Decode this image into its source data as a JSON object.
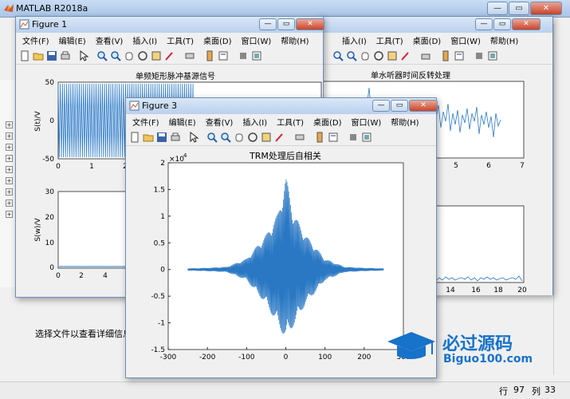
{
  "app": {
    "title": "MATLAB R2018a",
    "details_text": "选择文件以查看详细信息",
    "status": {
      "row_label": "行",
      "row_value": "97",
      "col_label": "列",
      "col_value": "33"
    }
  },
  "menus": [
    "文件(F)",
    "编辑(E)",
    "查看(V)",
    "插入(I)",
    "工具(T)",
    "桌面(D)",
    "窗口(W)",
    "帮助(H)"
  ],
  "window_buttons": {
    "minimize": "—",
    "restore": "▭",
    "close": "✕"
  },
  "figure1": {
    "title": "Figure 1",
    "plot_top": {
      "title": "单频矩形脉冲基源信号",
      "ylabel": "S(t)/V",
      "yticks": [
        "50",
        "0",
        "-50"
      ],
      "xticks": [
        "0",
        "1",
        "2",
        "3"
      ]
    },
    "plot_bottom": {
      "ylabel": "S(w)/V",
      "yticks": [
        "30",
        "20",
        "10",
        "0"
      ],
      "xticks": [
        "0",
        "2",
        "4",
        "6"
      ]
    }
  },
  "figure2": {
    "title_partial": "单水听器时间反转处理",
    "top_xticks": [
      "5",
      "6",
      "7"
    ],
    "bottom_xticks": [
      "14",
      "16",
      "18",
      "20"
    ]
  },
  "figure3": {
    "title": "Figure 3",
    "plot": {
      "title": "TRM处理后自相关",
      "exponent": "×10",
      "exponent_power": "4",
      "yticks": [
        "2",
        "1.5",
        "1",
        "0.5",
        "0",
        "-0.5",
        "-1",
        "-1.5"
      ],
      "xticks": [
        "-300",
        "-200",
        "-100",
        "0",
        "100",
        "200",
        "300"
      ]
    }
  },
  "watermark": {
    "line1": "必过源码",
    "line2": "Biguo100.com"
  },
  "chart_data": [
    {
      "type": "line",
      "title": "TRM处理后自相关",
      "xlabel": "",
      "ylabel": "",
      "xlim": [
        -300,
        300
      ],
      "ylim": [
        -1.5,
        2
      ],
      "y_scale_note": "×10^4",
      "series": [
        {
          "x": [
            -250,
            -200,
            -150,
            -100,
            -50,
            -20,
            0,
            20,
            50,
            100,
            150,
            200,
            250
          ],
          "envelope_upper": [
            0.02,
            0.03,
            0.05,
            0.2,
            0.65,
            1.05,
            1.75,
            1.05,
            0.65,
            0.2,
            0.05,
            0.03,
            0.02
          ],
          "envelope_lower": [
            -0.02,
            -0.03,
            -0.05,
            -0.2,
            -0.65,
            -1.05,
            -1.3,
            -1.05,
            -0.65,
            -0.2,
            -0.05,
            -0.03,
            -0.02
          ]
        }
      ]
    },
    {
      "type": "line",
      "title": "单频矩形脉冲基源信号",
      "xlim": [
        0,
        3
      ],
      "ylim": [
        -50,
        50
      ],
      "series": [
        {
          "x": [
            0,
            0.5,
            1,
            1.5
          ],
          "amplitude": [
            48,
            48,
            48,
            48
          ]
        }
      ]
    }
  ]
}
